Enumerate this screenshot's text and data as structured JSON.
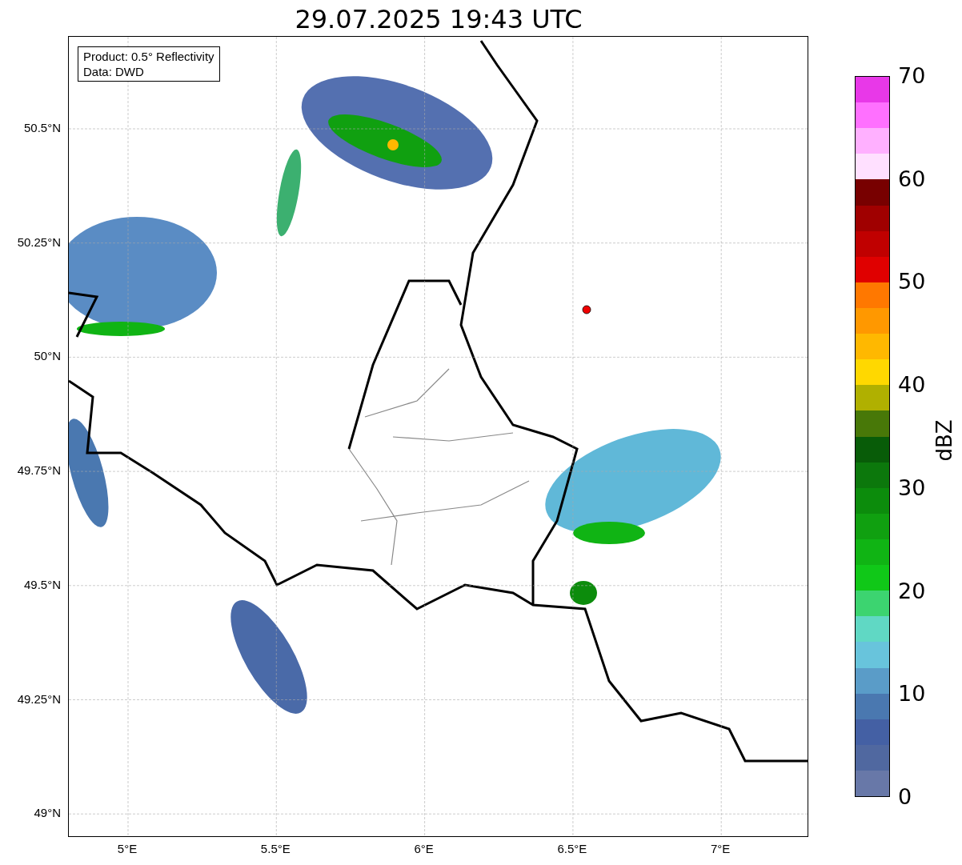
{
  "title": "29.07.2025 19:43 UTC",
  "info_box": [
    "Product: 0.5° Reflectivity",
    "Data: DWD"
  ],
  "map": {
    "y_ticks": [
      "50.5°N",
      "50.25°N",
      "50°N",
      "49.75°N",
      "49.5°N",
      "49.25°N",
      "49°N"
    ],
    "x_ticks": [
      "5°E",
      "5.5°E",
      "6°E",
      "6.5°E",
      "7°E"
    ]
  },
  "colorbar": {
    "label": "dBZ",
    "ticks": [
      "70",
      "60",
      "50",
      "40",
      "30",
      "20",
      "10",
      "0"
    ],
    "segments": [
      {
        "color": "#e838e8"
      },
      {
        "color": "#ff70ff"
      },
      {
        "color": "#ffb0ff"
      },
      {
        "color": "#ffe0ff"
      },
      {
        "color": "#780000"
      },
      {
        "color": "#a00000"
      },
      {
        "color": "#c00000"
      },
      {
        "color": "#e00000"
      },
      {
        "color": "#ff7800"
      },
      {
        "color": "#ff9800"
      },
      {
        "color": "#ffb800"
      },
      {
        "color": "#ffd800"
      },
      {
        "color": "#b0b000"
      },
      {
        "color": "#487808"
      },
      {
        "color": "#085c08"
      },
      {
        "color": "#0c780c"
      },
      {
        "color": "#0c8c0c"
      },
      {
        "color": "#10a010"
      },
      {
        "color": "#10b414"
      },
      {
        "color": "#10c818"
      },
      {
        "color": "#3cd470"
      },
      {
        "color": "#60d8c4"
      },
      {
        "color": "#68c4dc"
      },
      {
        "color": "#5a9cc8"
      },
      {
        "color": "#4a78b0"
      },
      {
        "color": "#4460a4"
      },
      {
        "color": "#5068a0"
      },
      {
        "color": "#6878a8"
      }
    ]
  }
}
